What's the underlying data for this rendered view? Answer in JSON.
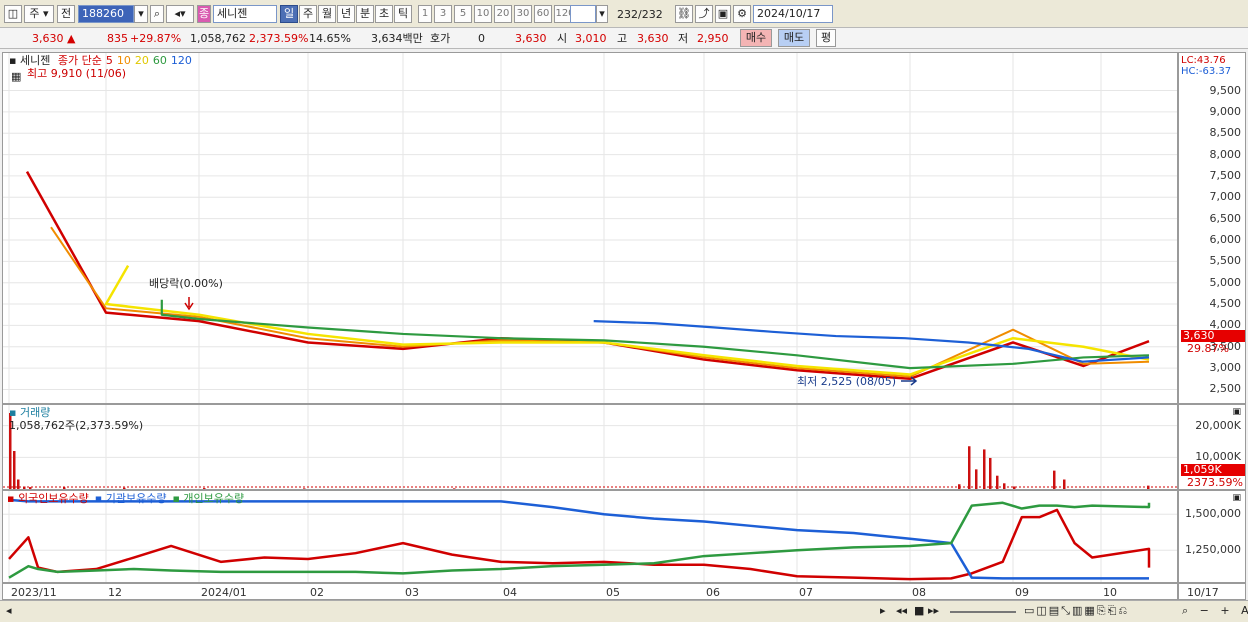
{
  "toolbar": {
    "market": "주",
    "prev": "전",
    "code": "188260",
    "name_badge": "종",
    "name": "세니젠",
    "periods": [
      "일",
      "주",
      "월",
      "년",
      "분",
      "초",
      "틱"
    ],
    "intervals": [
      "1",
      "3",
      "5",
      "10",
      "20",
      "30",
      "60",
      "120"
    ],
    "count": "232",
    "count_total": "/232",
    "date": "2024/10/17"
  },
  "quote": {
    "price": "3,630",
    "change": "835",
    "change_pct": "+29.87%",
    "volume": "1,058,762",
    "volume_pct": "2,373.59%",
    "turnover": "14.65%",
    "amount": "3,634백만",
    "hoga_label": "호가",
    "hoga_value": "0",
    "ask": "3,630",
    "open_label": "시",
    "open": "3,010",
    "high_label": "고",
    "high": "3,630",
    "low_label": "저",
    "low": "2,950",
    "buy": "매수",
    "sell": "매도",
    "avg": "평"
  },
  "price_panel": {
    "title": "세니젠",
    "legend": [
      {
        "label": "종가 단순",
        "color": "#d00000"
      },
      {
        "label": "5",
        "color": "#d00000"
      },
      {
        "label": "10",
        "color": "#f08c00"
      },
      {
        "label": "20",
        "color": "#e0c800"
      },
      {
        "label": "60",
        "color": "#2e9a40"
      },
      {
        "label": "120",
        "color": "#1d5fd6"
      }
    ],
    "high_note": "최고 9,910 (11/06)",
    "dividend_note": "배당락(0.00%)",
    "low_note": "최저 2,525 (08/05)",
    "lc": "LC:43.76",
    "hc": "HC:-63.37",
    "price_tag": "3,630",
    "pct_tag": "29.87%"
  },
  "volume_panel": {
    "title": "거래량",
    "last_note": "1,058,762주(2,373.59%)",
    "tag1": "1,059K",
    "tag2": "2373.59%"
  },
  "holding_panel": {
    "legend": [
      {
        "label": "외국인보유수량",
        "color": "#d00000"
      },
      {
        "label": "기관보유수량",
        "color": "#1d5fd6"
      },
      {
        "label": "개인보유수량",
        "color": "#2e9a40"
      }
    ]
  },
  "x_axis": {
    "labels": [
      "2023/11",
      "12",
      "2024/01",
      "02",
      "03",
      "04",
      "05",
      "06",
      "07",
      "08",
      "09",
      "10"
    ],
    "last": "10/17"
  },
  "chart_data": [
    {
      "type": "line",
      "name": "price",
      "ylim": [
        2300,
        9910
      ],
      "y_ticks": [
        2500,
        3000,
        3500,
        4000,
        4500,
        5000,
        5500,
        6000,
        6500,
        7000,
        7500,
        8000,
        8500,
        9000,
        9500
      ],
      "y_tick_labels": [
        "2,500",
        "3,000",
        "3,500",
        "4,000",
        "4,500",
        "5,000",
        "5,500",
        "6,000",
        "6,500",
        "7,000",
        "7,500",
        "8,000",
        "8,500",
        "9,000",
        "9,500"
      ],
      "x": [
        "2023/11",
        "12",
        "2024/01",
        "02",
        "03",
        "04",
        "05",
        "06",
        "07",
        "08",
        "09",
        "10"
      ],
      "series": [
        {
          "name": "5",
          "values": [
            7600,
            4300,
            4100,
            3600,
            3450,
            3700,
            3600,
            3200,
            2950,
            2750,
            3600,
            3050,
            3630
          ]
        },
        {
          "name": "10",
          "values": [
            6300,
            4400,
            4200,
            3700,
            3500,
            3650,
            3600,
            3250,
            3000,
            2800,
            3900,
            3100,
            3150
          ]
        },
        {
          "name": "20",
          "values": [
            5400,
            4500,
            4250,
            3800,
            3550,
            3600,
            3600,
            3300,
            3050,
            2850,
            3700,
            3500,
            3200
          ]
        },
        {
          "name": "60",
          "values": [
            4600,
            4250,
            4150,
            3950,
            3800,
            3700,
            3650,
            3500,
            3300,
            3000,
            3100,
            3250,
            3300
          ]
        },
        {
          "name": "120",
          "values": [
            4100,
            4050,
            3950,
            3850,
            3750,
            3700,
            3600,
            3450,
            3150,
            3250
          ]
        }
      ],
      "series_x_start": [
        0,
        0,
        0.3,
        1.6,
        5.9
      ],
      "points_x": [
        0,
        1,
        2,
        3,
        4,
        5,
        6,
        7,
        8,
        9,
        10,
        10.8,
        11.4
      ]
    },
    {
      "type": "bar",
      "name": "volume",
      "ylim": [
        0,
        24000
      ],
      "y_ticks": [
        10000,
        20000
      ],
      "y_tick_labels": [
        "10,000K",
        "20,000K"
      ],
      "values_k": [
        24000,
        12000,
        3000,
        800,
        600,
        500,
        400,
        300,
        200,
        200,
        1500,
        13500,
        6200,
        12500,
        9800,
        4200,
        1800,
        800,
        5800,
        3000,
        1059
      ]
    },
    {
      "type": "line",
      "name": "holdings",
      "ylim": [
        1030000,
        1620000
      ],
      "y_ticks": [
        1250000,
        1500000
      ],
      "y_tick_labels": [
        "1,250,000",
        "1,500,000"
      ],
      "x_idx": [
        0,
        0.2,
        0.3,
        0.5,
        0.9,
        1.3,
        1.7,
        2.2,
        2.6,
        3.0,
        3.5,
        4.0,
        4.5,
        5.0,
        5.5,
        6.0,
        6.5,
        7.0,
        7.5,
        8.0,
        8.5,
        9.0,
        9.4,
        9.6,
        9.9,
        10.1,
        10.3,
        10.5,
        10.7,
        10.9,
        11.1,
        11.3,
        11.5
      ],
      "series": [
        {
          "name": "외국인보유수량",
          "values": [
            1190,
            1340,
            1130,
            1100,
            1120,
            1200,
            1280,
            1170,
            1200,
            1190,
            1230,
            1300,
            1220,
            1170,
            1160,
            1170,
            1150,
            1150,
            1120,
            1070,
            1060,
            1050,
            1055,
            1090,
            1170,
            1480,
            1480,
            1530,
            1300,
            1200,
            1260,
            1220,
            1130
          ]
        },
        {
          "name": "기관보유수량",
          "values": [
            1600,
            1590,
            1590,
            1590,
            1590,
            1590,
            1590,
            1590,
            1590,
            1590,
            1590,
            1590,
            1590,
            1590,
            1550,
            1500,
            1470,
            1450,
            1420,
            1390,
            1370,
            1330,
            1300,
            1060,
            1055,
            1055,
            1055,
            1055,
            1055,
            1055,
            1055,
            1055,
            1055
          ]
        },
        {
          "name": "개인보유수량",
          "values": [
            1060,
            1140,
            1120,
            1100,
            1110,
            1120,
            1110,
            1100,
            1100,
            1100,
            1100,
            1090,
            1110,
            1120,
            1140,
            1150,
            1160,
            1210,
            1230,
            1250,
            1270,
            1280,
            1300,
            1560,
            1580,
            1540,
            1560,
            1560,
            1550,
            1560,
            1550,
            1570,
            1580
          ]
        }
      ]
    }
  ]
}
